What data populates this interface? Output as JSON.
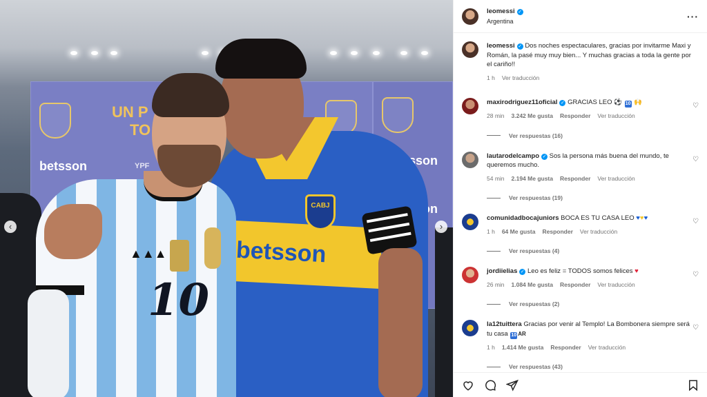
{
  "post": {
    "username": "leomessi",
    "location": "Argentina",
    "caption_user": "leomessi",
    "caption_text": "Dos noches espectaculares, gracias por invitarme Maxi y Román, la pasé muy muy bien... Y muchas gracias a toda la gente por el cariño!!",
    "caption_time": "1 h",
    "caption_translate": "Ver traducción"
  },
  "photo": {
    "banner_text_1": "UN P",
    "banner_text_2": "TO",
    "sponsor_1": "betsson",
    "sponsor_2": "YPF",
    "sponsor_3": "betsson",
    "sponsor_4": "betsson",
    "sponsor_5": "betsson",
    "jersey_text": "betsson",
    "jersey_number": "10",
    "crest": "CABJ",
    "adidas": "adidas"
  },
  "comments": [
    {
      "user": "maxirodriguez11oficial",
      "verified": true,
      "text": "GRACIAS LEO ⚽",
      "time": "28 min",
      "likes": "3.242 Me gusta",
      "reply": "Responder",
      "translate": "Ver traducción",
      "replies": "Ver respuestas (16)"
    },
    {
      "user": "lautarodelcampo",
      "verified": true,
      "text": "Sos la persona más buena del mundo, te queremos mucho.",
      "time": "54 min",
      "likes": "2.194 Me gusta",
      "reply": "Responder",
      "translate": "Ver traducción",
      "replies": "Ver respuestas (19)"
    },
    {
      "user": "comunidadbocajuniors",
      "verified": false,
      "text": "BOCA ES TU CASA LEO",
      "time": "1 h",
      "likes": "64 Me gusta",
      "reply": "Responder",
      "translate": "Ver traducción",
      "replies": "Ver respuestas (4)"
    },
    {
      "user": "jordiielias",
      "verified": true,
      "text": "Leo es feliz = TODOS somos felices",
      "time": "26 min",
      "likes": "1.084 Me gusta",
      "reply": "Responder",
      "translate": "Ver traducción",
      "replies": "Ver respuestas (2)"
    },
    {
      "user": "la12tuittera",
      "verified": false,
      "text": "Gracias por venir al Templo! La Bombonera siempre será tu casa",
      "time": "1 h",
      "likes": "1.414 Me gusta",
      "reply": "Responder",
      "translate": "Ver traducción",
      "replies": "Ver respuestas (43)"
    }
  ],
  "emoji": {
    "ten": "10",
    "ar": "AR"
  },
  "icons": {
    "more": "more-options-icon",
    "like": "heart-icon",
    "comment": "comment-icon",
    "share": "share-icon",
    "save": "bookmark-icon",
    "prev": "chevron-left-icon",
    "next": "chevron-right-icon"
  },
  "colors": {
    "verified": "#0095f6",
    "muted": "#737373",
    "text": "#262626",
    "boca_blue": "#1b3d8f",
    "boca_yellow": "#f2c62c"
  }
}
